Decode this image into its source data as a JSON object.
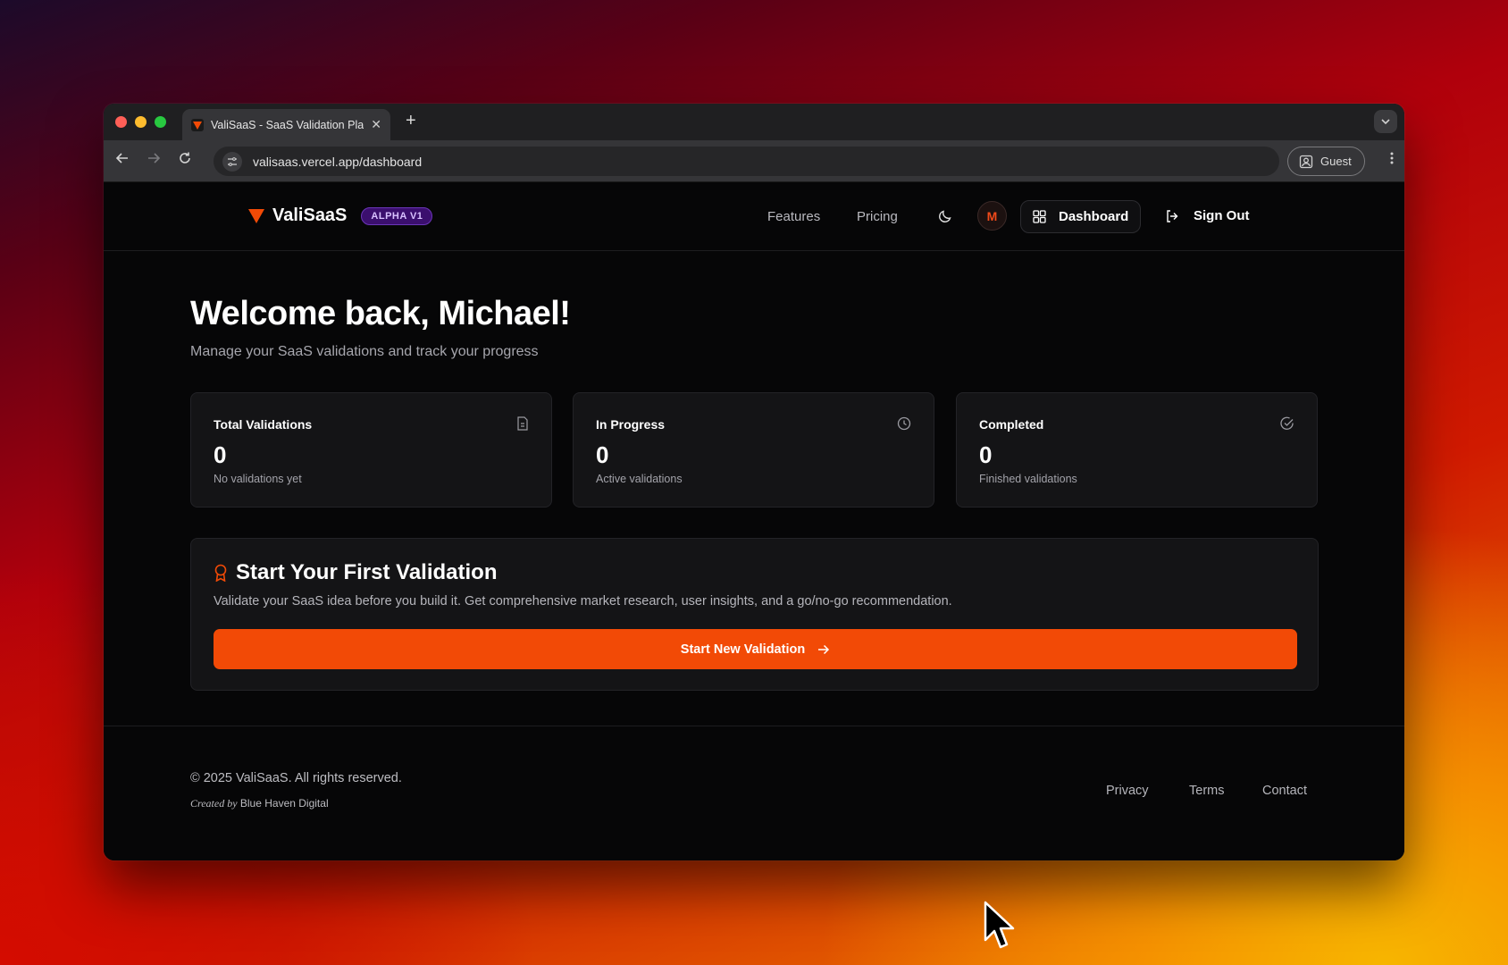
{
  "browser": {
    "tab_title": "ValiSaaS - SaaS Validation Pla",
    "url": "valisaas.vercel.app/dashboard",
    "profile_label": "Guest",
    "traffic_lights": [
      "#ff5f57",
      "#febc2e",
      "#28c840"
    ]
  },
  "header": {
    "brand_name": "ValiSaaS",
    "badge": "ALPHA V1",
    "nav": {
      "features": "Features",
      "pricing": "Pricing"
    },
    "avatar_initial": "M",
    "dashboard_label": "Dashboard",
    "signout_label": "Sign Out"
  },
  "main": {
    "welcome": "Welcome back, Michael!",
    "subtitle": "Manage your SaaS validations and track your progress",
    "stats": [
      {
        "label": "Total Validations",
        "value": "0",
        "sub": "No validations yet",
        "icon": "file-icon"
      },
      {
        "label": "In Progress",
        "value": "0",
        "sub": "Active validations",
        "icon": "clock-icon"
      },
      {
        "label": "Completed",
        "value": "0",
        "sub": "Finished validations",
        "icon": "check-circle-icon"
      }
    ],
    "cta": {
      "title": "Start Your First Validation",
      "description": "Validate your SaaS idea before you build it. Get comprehensive market research, user insights, and a go/no-go recommendation.",
      "button_label": "Start New Validation"
    }
  },
  "footer": {
    "copyright": "© 2025 ValiSaaS. All rights reserved.",
    "credit_prefix": "Created by",
    "credit_name": "Blue Haven Digital",
    "links": {
      "privacy": "Privacy",
      "terms": "Terms",
      "contact": "Contact"
    }
  },
  "colors": {
    "accent": "#f24a06",
    "badge_bg": "#3b0f6e"
  }
}
